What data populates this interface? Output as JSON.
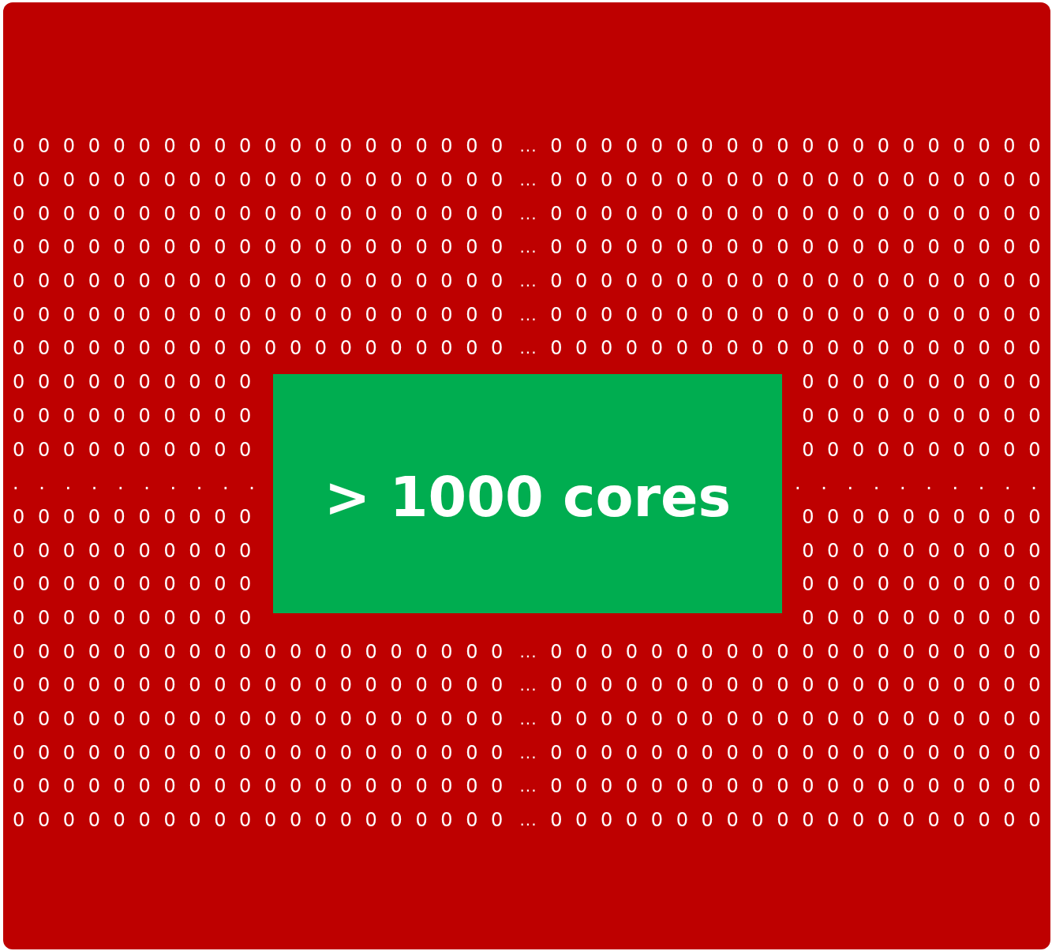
{
  "rows": [
    {
      "kind": "zeros",
      "left": "0 0 0 0 0 0 0 0 0 0 0 0 0 0 0 0 0 0 0 0",
      "middle": "...",
      "right": "0 0 0 0 0 0 0 0 0 0 0 0 0 0 0 0 0 0 0 0"
    },
    {
      "kind": "zeros",
      "left": "0 0 0 0 0 0 0 0 0 0 0 0 0 0 0 0 0 0 0 0",
      "middle": "...",
      "right": "0 0 0 0 0 0 0 0 0 0 0 0 0 0 0 0 0 0 0 0"
    },
    {
      "kind": "zeros",
      "left": "0 0 0 0 0 0 0 0 0 0 0 0 0 0 0 0 0 0 0 0",
      "middle": "...",
      "right": "0 0 0 0 0 0 0 0 0 0 0 0 0 0 0 0 0 0 0 0"
    },
    {
      "kind": "zeros",
      "left": "0 0 0 0 0 0 0 0 0 0 0 0 0 0 0 0 0 0 0 0",
      "middle": "...",
      "right": "0 0 0 0 0 0 0 0 0 0 0 0 0 0 0 0 0 0 0 0"
    },
    {
      "kind": "zeros",
      "left": "0 0 0 0 0 0 0 0 0 0 0 0 0 0 0 0 0 0 0 0",
      "middle": "...",
      "right": "0 0 0 0 0 0 0 0 0 0 0 0 0 0 0 0 0 0 0 0"
    },
    {
      "kind": "zeros",
      "left": "0 0 0 0 0 0 0 0 0 0 0 0 0 0 0 0 0 0 0 0",
      "middle": "...",
      "right": "0 0 0 0 0 0 0 0 0 0 0 0 0 0 0 0 0 0 0 0"
    },
    {
      "kind": "zeros",
      "left": "0 0 0 0 0 0 0 0 0 0 0 0 0 0 0 0 0 0 0 0",
      "middle": "...",
      "right": "0 0 0 0 0 0 0 0 0 0 0 0 0 0 0 0 0 0 0 0"
    },
    {
      "kind": "zeros",
      "left": "0 0 0 0 0 0 0 0 0 0",
      "right": "0 0 0 0 0 0 0 0 0 0"
    },
    {
      "kind": "zeros",
      "left": "0 0 0 0 0 0 0 0 0 0",
      "right": "0 0 0 0 0 0 0 0 0 0"
    },
    {
      "kind": "zeros",
      "left": "0 0 0 0 0 0 0 0 0 0",
      "right": "0 0 0 0 0 0 0 0 0 0"
    },
    {
      "kind": "dots",
      "left": ". . . . . . . . . .",
      "right": ". . . . . . . . . ."
    },
    {
      "kind": "zeros",
      "left": "0 0 0 0 0 0 0 0 0 0",
      "right": "0 0 0 0 0 0 0 0 0 0"
    },
    {
      "kind": "zeros",
      "left": "0 0 0 0 0 0 0 0 0 0",
      "right": "0 0 0 0 0 0 0 0 0 0"
    },
    {
      "kind": "zeros",
      "left": "0 0 0 0 0 0 0 0 0 0",
      "right": "0 0 0 0 0 0 0 0 0 0"
    },
    {
      "kind": "zeros",
      "left": "0 0 0 0 0 0 0 0 0 0",
      "right": "0 0 0 0 0 0 0 0 0 0"
    },
    {
      "kind": "zeros",
      "left": "0 0 0 0 0 0 0 0 0 0 0 0 0 0 0 0 0 0 0 0",
      "middle": "...",
      "right": "0 0 0 0 0 0 0 0 0 0 0 0 0 0 0 0 0 0 0 0"
    },
    {
      "kind": "zeros",
      "left": "0 0 0 0 0 0 0 0 0 0 0 0 0 0 0 0 0 0 0 0",
      "middle": "...",
      "right": "0 0 0 0 0 0 0 0 0 0 0 0 0 0 0 0 0 0 0 0"
    },
    {
      "kind": "zeros",
      "left": "0 0 0 0 0 0 0 0 0 0 0 0 0 0 0 0 0 0 0 0",
      "middle": "...",
      "right": "0 0 0 0 0 0 0 0 0 0 0 0 0 0 0 0 0 0 0 0"
    },
    {
      "kind": "zeros",
      "left": "0 0 0 0 0 0 0 0 0 0 0 0 0 0 0 0 0 0 0 0",
      "middle": "...",
      "right": "0 0 0 0 0 0 0 0 0 0 0 0 0 0 0 0 0 0 0 0"
    },
    {
      "kind": "zeros",
      "left": "0 0 0 0 0 0 0 0 0 0 0 0 0 0 0 0 0 0 0 0",
      "middle": "...",
      "right": "0 0 0 0 0 0 0 0 0 0 0 0 0 0 0 0 0 0 0 0"
    },
    {
      "kind": "zeros",
      "left": "0 0 0 0 0 0 0 0 0 0 0 0 0 0 0 0 0 0 0 0",
      "middle": "...",
      "right": "0 0 0 0 0 0 0 0 0 0 0 0 0 0 0 0 0 0 0 0"
    }
  ],
  "callout": "> 1000 cores"
}
